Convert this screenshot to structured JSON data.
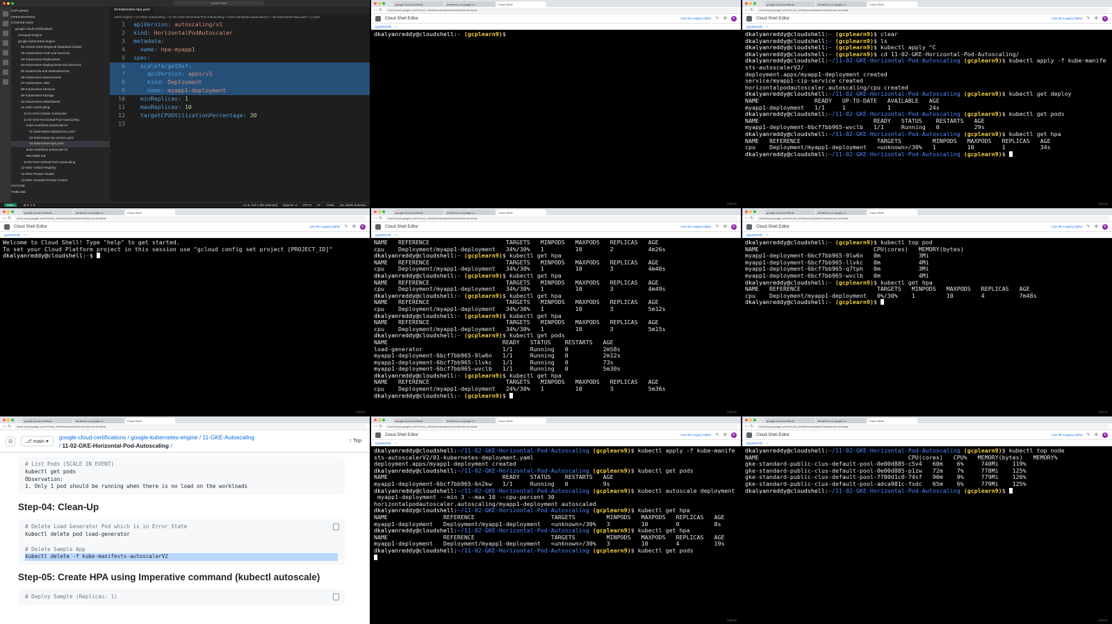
{
  "vscode": {
    "title_search": "course-new",
    "explorer_label": "EXPLORER",
    "open_editors": "OPEN EDITORS",
    "root": "COURSE-NEW",
    "tree": [
      "google-cloud-certifications",
      "Compute-Engine",
      "google-kubernetes-engine",
      "01-Create-GKE-Regional-Standard-Cluster",
      "02-Kubernetes-Pods-and-Services",
      "03-Kubernetes-ReplicaSets",
      "04-Kubernetes-Deployments-and-Services",
      "05-NodePools-and-NodeSelectors",
      "06-Kubernetes-DaemonSets",
      "07-Kubernetes-Jobs",
      "08-Kubernetes-Services",
      "09-Kubernetes-Storage",
      "10-Kubernetes-StatefulSets",
      "11-GKE-Autoscaling",
      "11-01-GKE-Cluster-Autoscaler",
      "11-02-GKE-Horizontal-Pod-Autoscaling",
      "kube-manifests-autoscalerV1",
      "01-kubernetes-deployment.yaml",
      "02-kubernetes-cip-service.yaml",
      "03-kubernetes-hpa.yaml",
      "kube-manifests-autoscalerV2",
      "README.md",
      "11-03-GKE-Vertical-Pod-Autoscaling",
      "12-GKE-Artifact-Registry",
      "13-GKE-Private-Cluster",
      "14-GKE-Autopilot-Private-Cluster"
    ],
    "outline": "OUTLINE",
    "timeline": "TIMELINE",
    "tab": "03-kubernetes-hpa.yaml",
    "breadcrumb": "netes-engine > 11-GKE-Autoscaling > 11-02-GKE-Horizontal-Pod-Autoscaling > kube-manifests-autoscalerV1 > 03-kubernetes-hpa.yaml > {} spec",
    "code": [
      {
        "n": "1",
        "k": "apiVersion:",
        "v": " autoscaling/v1"
      },
      {
        "n": "2",
        "k": "kind:",
        "v": " HorizontalPodAutoscaler"
      },
      {
        "n": "3",
        "k": "metadata:",
        "v": ""
      },
      {
        "n": "4",
        "k": "  name:",
        "v": " hpa-myapp1"
      },
      {
        "n": "5",
        "k": "spec:",
        "v": ""
      },
      {
        "n": "6",
        "k": "  scaleTargetRef:",
        "v": ""
      },
      {
        "n": "7",
        "k": "    apiVersion:",
        "v": " apps/v1"
      },
      {
        "n": "8",
        "k": "    kind:",
        "v": " Deployment"
      },
      {
        "n": "9",
        "k": "    name:",
        "v": " myapp1-deployment"
      },
      {
        "n": "10",
        "k": "  minReplicas:",
        "v": " 1"
      },
      {
        "n": "11",
        "k": "  maxReplicas:",
        "v": " 10"
      },
      {
        "n": "12",
        "k": "  targetCPUUtilizationPercentage:",
        "v": " 30"
      },
      {
        "n": "13",
        "k": "",
        "v": ""
      }
    ],
    "status_branch": "main",
    "status_errors": "⊗ 0 ⚠ 0",
    "status_right": [
      "Ln 6, Col 1 (95 selected)",
      "Spaces: 2",
      "UTF-8",
      "LF",
      "YAML",
      "No JSON Schema"
    ]
  },
  "browser": {
    "tab_labels": [
      "google-cloud-certificat...",
      "terraform-on-google-cl...",
      "Cloud Shell"
    ],
    "url": "shell.cloud.google.com/?hl=en_US&fromcloudshell=true&show=terminal",
    "cloud_shell_title": "Cloud Shell Editor",
    "legacy": "Use the Legacy Editor",
    "session_tab": "(gcplearn9)",
    "add_tab": "+",
    "watermark": "Udemy",
    "avatar": "K"
  },
  "prompt": {
    "user": "dkalyanreddy@cloudshell:",
    "home": "~",
    "hpa_dir": "~/11-02-GKE-Horizontal-Pod-Autoscaling",
    "project": "(gcplearn9)"
  },
  "term1": {
    "lines": [
      {
        "path": "~",
        "cmd": ""
      }
    ]
  },
  "term2": {
    "lines": [
      {
        "t": "p",
        "path": "~",
        "cmd": " clear"
      },
      {
        "t": "p",
        "path": "~",
        "cmd": " ls"
      },
      {
        "t": "p",
        "path": "~",
        "cmd": " kubectl apply ^C"
      },
      {
        "t": "p",
        "path": "~",
        "cmd": " cd 11-02-GKE-Horizontal-Pod-Autoscaling/"
      },
      {
        "t": "p",
        "path": "hpa",
        "cmd": " kubectl apply -f kube-manife"
      },
      {
        "t": "o",
        "text": "sts-autoscalerV2/"
      },
      {
        "t": "o",
        "text": "deployment.apps/myapp1-deployment created"
      },
      {
        "t": "o",
        "text": "service/myapp1-cip-service created"
      },
      {
        "t": "o",
        "text": "horizontalpodautoscaler.autoscaling/cpu created"
      },
      {
        "t": "p",
        "path": "hpa",
        "cmd": " kubectl get deploy"
      },
      {
        "t": "o",
        "text": "NAME                READY   UP-TO-DATE   AVAILABLE   AGE"
      },
      {
        "t": "o",
        "text": "myapp1-deployment   1/1     1            1           24s"
      },
      {
        "t": "p",
        "path": "hpa",
        "cmd": " kubectl get pods"
      },
      {
        "t": "o",
        "text": "NAME                                 READY   STATUS    RESTARTS   AGE"
      },
      {
        "t": "o",
        "text": "myapp1-deployment-6bcf7bb965-wvclb   1/1     Running   0          29s"
      },
      {
        "t": "p",
        "path": "hpa",
        "cmd": " kubectl get hpa"
      },
      {
        "t": "o",
        "text": "NAME   REFERENCE                      TARGETS         MINPODS   MAXPODS   REPLICAS   AGE"
      },
      {
        "t": "o",
        "text": "cpu    Deployment/myapp1-deployment   <unknown>/30%   1         10        1          34s"
      },
      {
        "t": "p",
        "path": "hpa",
        "cmd": " ",
        "cursor": true
      }
    ]
  },
  "term3": {
    "lines": [
      {
        "t": "o",
        "text": "Welcome to Cloud Shell! Type \"help\" to get started."
      },
      {
        "t": "o",
        "text": "To set your Cloud Platform project in this session use \"gcloud config set project [PROJECT_ID]\""
      },
      {
        "t": "p0",
        "path": "~",
        "cmd": " ",
        "cursor": true
      }
    ]
  },
  "term4": {
    "lines": [
      {
        "t": "o",
        "text": "NAME   REFERENCE                      TARGETS   MINPODS   MAXPODS   REPLICAS   AGE"
      },
      {
        "t": "o",
        "text": "cpu    Deployment/myapp1-deployment   34%/30%   1         10        2          4m26s"
      },
      {
        "t": "p",
        "path": "~",
        "cmd": " kubectl get hpa"
      },
      {
        "t": "o",
        "text": "NAME   REFERENCE                      TARGETS   MINPODS   MAXPODS   REPLICAS   AGE"
      },
      {
        "t": "o",
        "text": "cpu    Deployment/myapp1-deployment   34%/30%   1         10        3          4m40s"
      },
      {
        "t": "p",
        "path": "~",
        "cmd": " kubectl get hpa"
      },
      {
        "t": "o",
        "text": "NAME   REFERENCE                      TARGETS   MINPODS   MAXPODS   REPLICAS   AGE"
      },
      {
        "t": "o",
        "text": "cpu    Deployment/myapp1-deployment   34%/30%   1         10        3          4m49s"
      },
      {
        "t": "p",
        "path": "~",
        "cmd": " kubectl get hpa"
      },
      {
        "t": "o",
        "text": "NAME   REFERENCE                      TARGETS   MINPODS   MAXPODS   REPLICAS   AGE"
      },
      {
        "t": "o",
        "text": "cpu    Deployment/myapp1-deployment   34%/30%   1         10        3          5m12s"
      },
      {
        "t": "p",
        "path": "~",
        "cmd": " kubectl get hpa"
      },
      {
        "t": "o",
        "text": "NAME   REFERENCE                      TARGETS   MINPODS   MAXPODS   REPLICAS   AGE"
      },
      {
        "t": "o",
        "text": "cpu    Deployment/myapp1-deployment   34%/30%   1         10        3          5m15s"
      },
      {
        "t": "p",
        "path": "~",
        "cmd": " kubectl get pods"
      },
      {
        "t": "o",
        "text": "NAME                                 READY   STATUS    RESTARTS   AGE"
      },
      {
        "t": "o",
        "text": "load-generator                       1/1     Running   0          2m58s"
      },
      {
        "t": "o",
        "text": "myapp1-deployment-6bcf7bb965-9lw6n   1/1     Running   0          2m12s"
      },
      {
        "t": "o",
        "text": "myapp1-deployment-6bcf7bb965-llvkc   1/1     Running   0          73s"
      },
      {
        "t": "o",
        "text": "myapp1-deployment-6bcf7bb965-wvclb   1/1     Running   0          5m30s"
      },
      {
        "t": "p",
        "path": "~",
        "cmd": " kubectl get hpa"
      },
      {
        "t": "o",
        "text": "NAME   REFERENCE                      TARGETS   MINPODS   MAXPODS   REPLICAS   AGE"
      },
      {
        "t": "o",
        "text": "cpu    Deployment/myapp1-deployment   24%/30%   1         10        3          5m36s"
      },
      {
        "t": "p",
        "path": "~",
        "cmd": " ",
        "cursor": true
      }
    ]
  },
  "term5": {
    "lines": [
      {
        "t": "p",
        "path": "~",
        "cmd": " kubectl top pod"
      },
      {
        "t": "o",
        "text": "NAME                                 CPU(cores)   MEMORY(bytes)"
      },
      {
        "t": "o",
        "text": "myapp1-deployment-6bcf7bb965-9lw6n   0m           3Mi"
      },
      {
        "t": "o",
        "text": "myapp1-deployment-6bcf7bb965-llvkc   0m           4Mi"
      },
      {
        "t": "o",
        "text": "myapp1-deployment-6bcf7bb965-q7tph   0m           3Mi"
      },
      {
        "t": "o",
        "text": "myapp1-deployment-6bcf7bb965-wvclb   0m           4Mi"
      },
      {
        "t": "p",
        "path": "~",
        "cmd": " kubectl get hpa"
      },
      {
        "t": "o",
        "text": "NAME   REFERENCE                      TARGETS   MINPODS   MAXPODS   REPLICAS   AGE"
      },
      {
        "t": "o",
        "text": "cpu    Deployment/myapp1-deployment   0%/30%    1         10        4          7m48s"
      },
      {
        "t": "p",
        "path": "~",
        "cmd": " ",
        "cursor": true
      }
    ]
  },
  "doc": {
    "branch": "main",
    "path_parts": [
      "google-cloud-certifications",
      "google-kubernetes-engine",
      "11-GKE-Autoscaling"
    ],
    "path_current": "11-02-GKE-Horizontal-Pod-Autoscaling",
    "top": "Top",
    "block1": [
      "# List Pods (SCALE IN EVENT)",
      "kubectl get pods",
      "Observation:",
      "1. Only 1 pod should be running when there is no load on the workloads"
    ],
    "heading1": "Step-04: Clean-Up",
    "block2": [
      "# Delete Load Generator Pod which is in Error State",
      "kubectl delete pod load-generator",
      "",
      "# Delete Sample App",
      "kubectl delete -f kube-manifests-autoscalerV2"
    ],
    "heading2": "Step-05: Create HPA using Imperative command (kubectl autoscale)",
    "block3": [
      "# Deploy Sample (Replicas: 1)"
    ]
  },
  "term7": {
    "lines": [
      {
        "t": "p",
        "path": "hpa",
        "cmd": " kubectl apply -f kube-manife"
      },
      {
        "t": "o",
        "text": "sts-autoscalerV2/01-kubernetes-deployment.yaml"
      },
      {
        "t": "o",
        "text": "deployment.apps/myapp1-deployment created"
      },
      {
        "t": "p",
        "path": "hpa",
        "cmd": " kubectl get pods"
      },
      {
        "t": "o",
        "text": "NAME                                 READY   STATUS    RESTARTS   AGE"
      },
      {
        "t": "o",
        "text": "myapp1-deployment-6bcf7bb965-6n2kw   1/1     Running   0          9s"
      },
      {
        "t": "p",
        "path": "hpa",
        "cmd": " kubectl autoscale deployment"
      },
      {
        "t": "o",
        "text": " myapp1-deployment --min 3 --max 10 --cpu-percent 30"
      },
      {
        "t": "o",
        "text": "horizontalpodautoscaler.autoscaling/myapp1-deployment autoscaled"
      },
      {
        "t": "p",
        "path": "hpa",
        "cmd": " kubectl get hpa"
      },
      {
        "t": "o",
        "text": "NAME                REFERENCE                      TARGETS         MINPODS   MAXPODS   REPLICAS   AGE"
      },
      {
        "t": "o",
        "text": "myapp1-deployment   Deployment/myapp1-deployment   <unknown>/30%   3         10        0          8s"
      },
      {
        "t": "p",
        "path": "hpa",
        "cmd": " kubectl get hpa"
      },
      {
        "t": "o",
        "text": "NAME                REFERENCE                      TARGETS         MINPODS   MAXPODS   REPLICAS   AGE"
      },
      {
        "t": "o",
        "text": "myapp1-deployment   Deployment/myapp1-deployment   <unknown>/30%   3         10        4          19s"
      },
      {
        "t": "p",
        "path": "hpa",
        "cmd": " kubectl get pods"
      },
      {
        "t": "c",
        "text": ""
      }
    ]
  },
  "term8": {
    "lines": [
      {
        "t": "p",
        "path": "hpa",
        "cmd": " kubectl top node"
      },
      {
        "t": "o",
        "text": "NAME                                           CPU(cores)   CPU%   MEMORY(bytes)   MEMORY%"
      },
      {
        "t": "o",
        "text": "gke-standard-public-clus-default-pool-0e00d885-c5v4   60m    6%     740Mi    119%"
      },
      {
        "t": "o",
        "text": "gke-standard-public-clus-default-pool-0e00d885-p1zw   72m    7%     778Mi    125%"
      },
      {
        "t": "o",
        "text": "gke-standard-public-clus-default-pool-7780d1c0-74sf   90m    9%     779Mi    126%"
      },
      {
        "t": "o",
        "text": "gke-standard-public-clus-default-pool-adca981c-fsdc   65m    6%     779Mi    125%"
      },
      {
        "t": "p",
        "path": "hpa",
        "cmd": " ",
        "cursor": true
      }
    ]
  }
}
